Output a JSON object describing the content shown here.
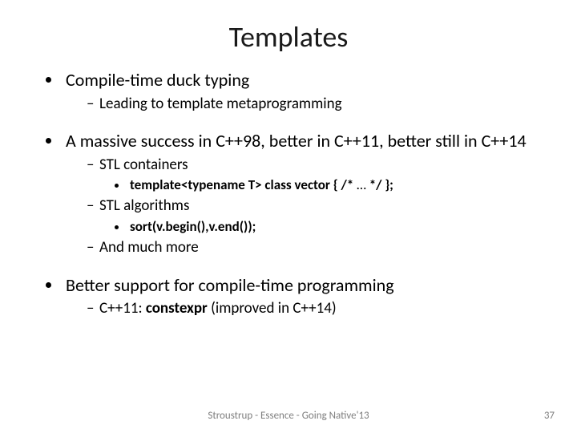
{
  "title": "Templates",
  "bullets": {
    "b1": {
      "text": "Compile-time duck typing",
      "sub": {
        "s1": "Leading to template metaprogramming"
      }
    },
    "b2": {
      "text": "A massive success in C++98, better in C++11, better still in C++14",
      "sub": {
        "s1": "STL containers",
        "s1_code_a": "template<typename T> class vector { /* ",
        "s1_code_b": "…",
        "s1_code_c": " */ };",
        "s2": "STL algorithms",
        "s2_code": "sort(v.begin(),v.end());",
        "s3": "And much more"
      }
    },
    "b3": {
      "text": "Better support for compile-time programming",
      "sub": {
        "s1_a": "C++11: ",
        "s1_b": "constexpr",
        "s1_c": " (improved in C++14)"
      }
    }
  },
  "footer": "Stroustrup - Essence - Going Native'13",
  "page": "37"
}
